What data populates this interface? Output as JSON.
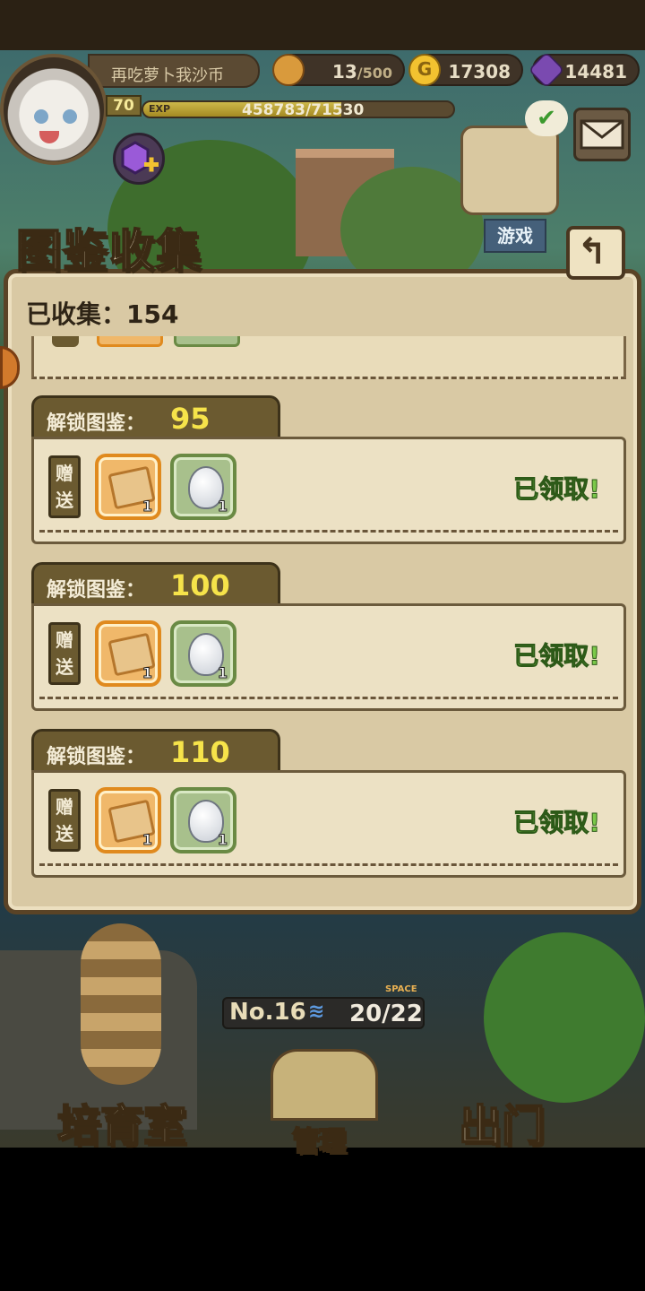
{
  "header": {
    "player_name": "再吃萝卜我沙币",
    "level": "70",
    "exp_label": "EXP",
    "exp_value": "458783/71530",
    "exp_progress": 0.64,
    "stamina": {
      "current": "13",
      "max": "/500"
    },
    "gold": "17308",
    "gems": "14481"
  },
  "side_buttons": {
    "games_label": "游戏"
  },
  "panel": {
    "title": "图鉴收集",
    "collected_text": "已收集：154",
    "back_label": "↰",
    "entries": [
      {
        "label": "解锁图鉴：",
        "threshold": "95",
        "gift_label": "赠送",
        "rewards": [
          {
            "icon": "ticket-icon",
            "count": "1"
          },
          {
            "icon": "egg-icon",
            "count": "1"
          }
        ],
        "status": "已领取!"
      },
      {
        "label": "解锁图鉴：",
        "threshold": "100",
        "gift_label": "赠送",
        "rewards": [
          {
            "icon": "ticket-icon",
            "count": "1"
          },
          {
            "icon": "egg-icon",
            "count": "1"
          }
        ],
        "status": "已领取!"
      },
      {
        "label": "解锁图鉴：",
        "threshold": "110",
        "gift_label": "赠送",
        "rewards": [
          {
            "icon": "ticket-icon",
            "count": "1"
          },
          {
            "icon": "egg-icon",
            "count": "1"
          }
        ],
        "status": "已领取!"
      }
    ]
  },
  "bottom": {
    "room_no": "No.16",
    "space_label": "SPACE",
    "space_value": "20/22",
    "nav_left": "培育室",
    "nav_center": "管理",
    "nav_right": "出门"
  },
  "colors": {
    "claimed_green": "#7bc94a",
    "threshold_yellow": "#f6e34a",
    "panel_bg": "#d9c9a4"
  }
}
